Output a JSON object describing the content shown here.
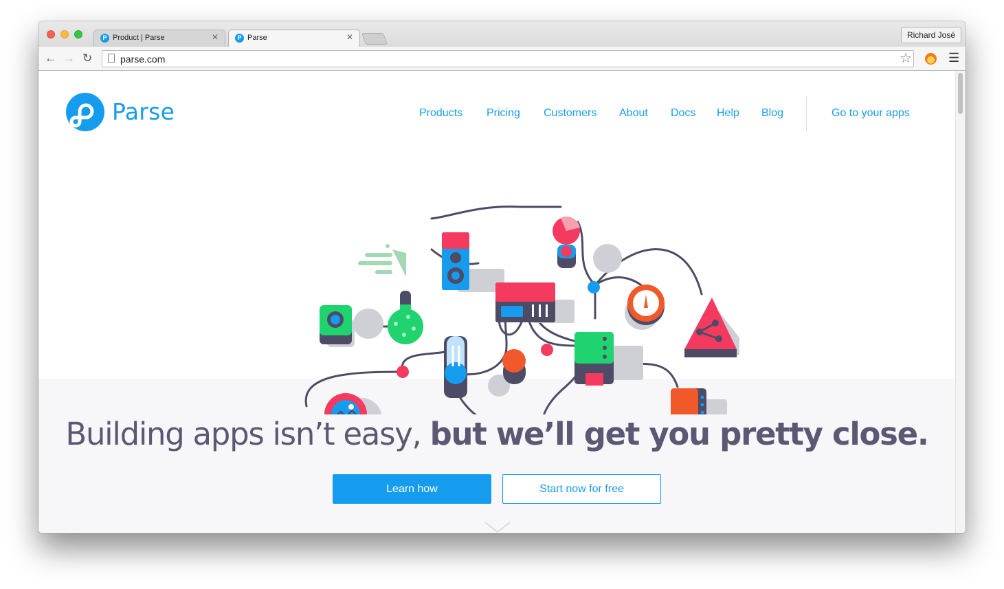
{
  "browser": {
    "tabs": [
      {
        "title": "Product | Parse",
        "active": false
      },
      {
        "title": "Parse",
        "active": true
      }
    ],
    "profile_name": "Richard José",
    "url": "parse.com",
    "icons": {
      "back": "back-arrow-icon",
      "forward": "forward-arrow-icon",
      "reload": "reload-icon",
      "bookmark": "star-icon",
      "extension": "firefox-like-extension-icon",
      "menu": "hamburger-menu-icon"
    }
  },
  "site": {
    "logo_text": "Parse",
    "nav": [
      {
        "label": "Products"
      },
      {
        "label": "Pricing"
      },
      {
        "label": "Customers"
      },
      {
        "label": "About"
      },
      {
        "label": "Docs"
      },
      {
        "label": "Help"
      },
      {
        "label": "Blog"
      }
    ],
    "apps_link": "Go to your apps"
  },
  "hero": {
    "headline_light": "Building apps isn’t easy, ",
    "headline_bold": "but we’ll get you pretty close.",
    "primary_button": "Learn how",
    "secondary_button": "Start now for free"
  },
  "colors": {
    "brand_blue": "#169cee",
    "headline": "#5a5873",
    "band": "#f7f6f8"
  }
}
